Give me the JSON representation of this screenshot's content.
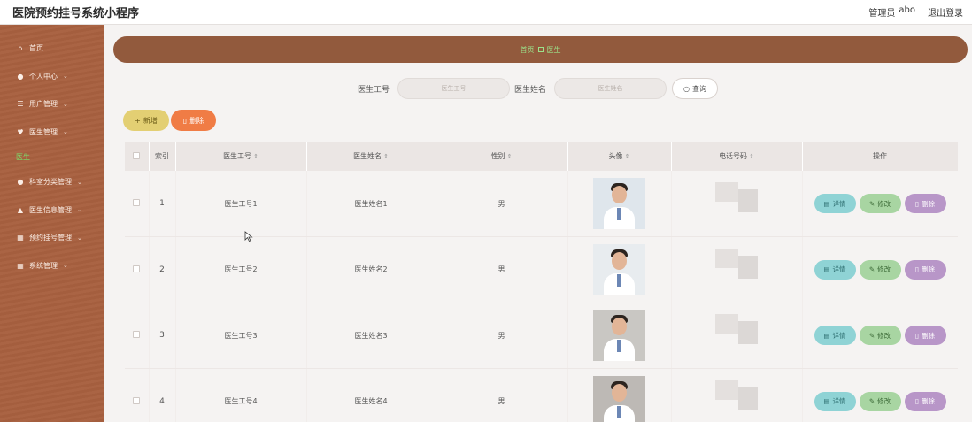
{
  "header": {
    "app_title": "医院预约挂号系统小程序",
    "role": "管理员",
    "username": "abo",
    "logout_label": "退出登录"
  },
  "sidebar": {
    "items": [
      {
        "label": "首页",
        "icon": "home-icon",
        "glyph": "⌂",
        "chevron": false
      },
      {
        "label": "个人中心",
        "icon": "user-icon",
        "glyph": "●",
        "chevron": true
      },
      {
        "label": "用户管理",
        "icon": "menu-icon",
        "glyph": "☰",
        "chevron": true
      },
      {
        "label": "医生管理",
        "icon": "doctor-icon",
        "glyph": "♥",
        "chevron": true
      },
      {
        "label": "医生",
        "icon": "",
        "glyph": "",
        "chevron": false,
        "sub": true
      },
      {
        "label": "科室分类管理",
        "icon": "user-icon",
        "glyph": "●",
        "chevron": true
      },
      {
        "label": "医生信息管理",
        "icon": "upload-icon",
        "glyph": "▲",
        "chevron": true
      },
      {
        "label": "预约挂号管理",
        "icon": "grid-icon",
        "glyph": "▦",
        "chevron": true
      },
      {
        "label": "系统管理",
        "icon": "grid-icon",
        "glyph": "▦",
        "chevron": true
      }
    ]
  },
  "breadcrumb": {
    "home": "首页",
    "current": "医生"
  },
  "search": {
    "doc_id_label": "医生工号",
    "doc_id_placeholder": "医生工号",
    "doc_name_label": "医生姓名",
    "doc_name_placeholder": "医生姓名",
    "search_label": "查询"
  },
  "actions": {
    "add_label": "新增",
    "delete_label": "删除"
  },
  "table": {
    "columns": [
      "索引",
      "医生工号",
      "医生姓名",
      "性别",
      "头像",
      "电话号码",
      "操作"
    ],
    "rows": [
      {
        "index": "1",
        "doc_id": "医生工号1",
        "name": "医生姓名1",
        "gender": "男",
        "avatar_bg": "#dfe6ec"
      },
      {
        "index": "2",
        "doc_id": "医生工号2",
        "name": "医生姓名2",
        "gender": "男",
        "avatar_bg": "#e8ecef"
      },
      {
        "index": "3",
        "doc_id": "医生工号3",
        "name": "医生姓名3",
        "gender": "男",
        "avatar_bg": "#c9c7c3"
      },
      {
        "index": "4",
        "doc_id": "医生工号4",
        "name": "医生姓名4",
        "gender": "男",
        "avatar_bg": "#bdb9b5"
      }
    ],
    "op_labels": {
      "detail": "详情",
      "edit": "修改",
      "delete": "删除"
    }
  }
}
